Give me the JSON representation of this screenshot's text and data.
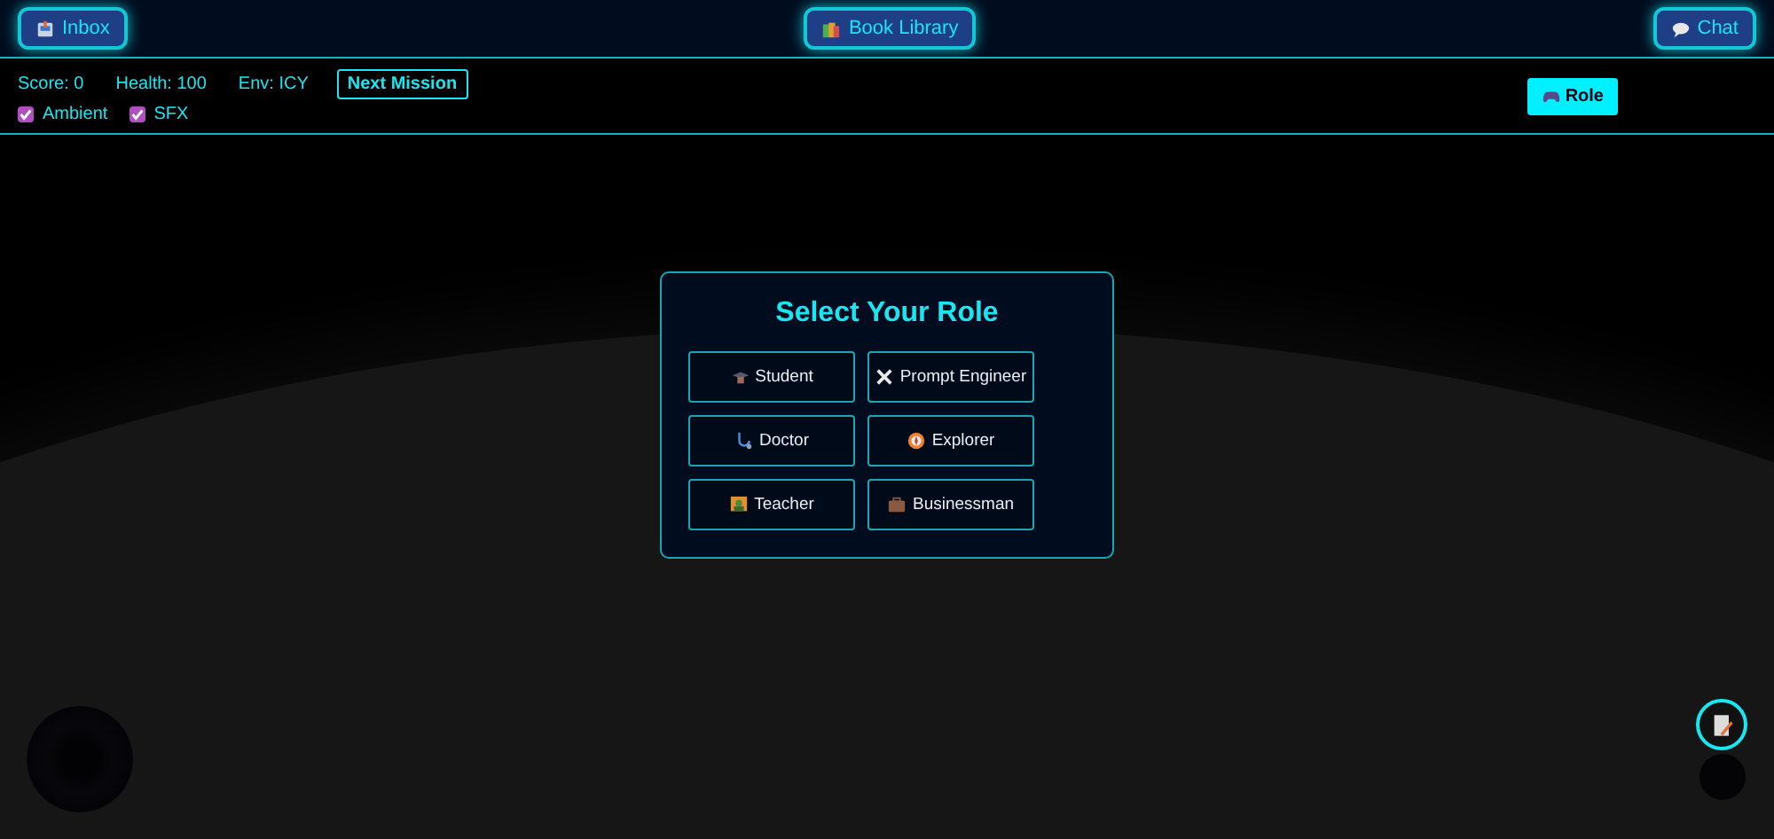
{
  "top_bar": {
    "buttons": [
      {
        "kind": "inbox",
        "label": "Inbox"
      },
      {
        "kind": "library",
        "label": "Book Library"
      },
      {
        "kind": "chat",
        "label": "Chat"
      }
    ]
  },
  "hud": {
    "stats": [
      "Score: 0",
      "Health: 100",
      "Env: ICY"
    ],
    "mission_button": "Next Mission",
    "toggles": [
      {
        "label": "Ambient",
        "checked": true
      },
      {
        "label": "SFX",
        "checked": true
      }
    ],
    "role_button": "Role"
  },
  "role_dialog": {
    "title": "Select Your Role",
    "roles": [
      {
        "kind": "student",
        "label": "Student"
      },
      {
        "kind": "engineer",
        "label": "Prompt Engineer"
      },
      {
        "kind": "doctor",
        "label": "Doctor"
      },
      {
        "kind": "explorer",
        "label": "Explorer"
      },
      {
        "kind": "teacher",
        "label": "Teacher"
      },
      {
        "kind": "business",
        "label": "Businessman"
      }
    ]
  }
}
